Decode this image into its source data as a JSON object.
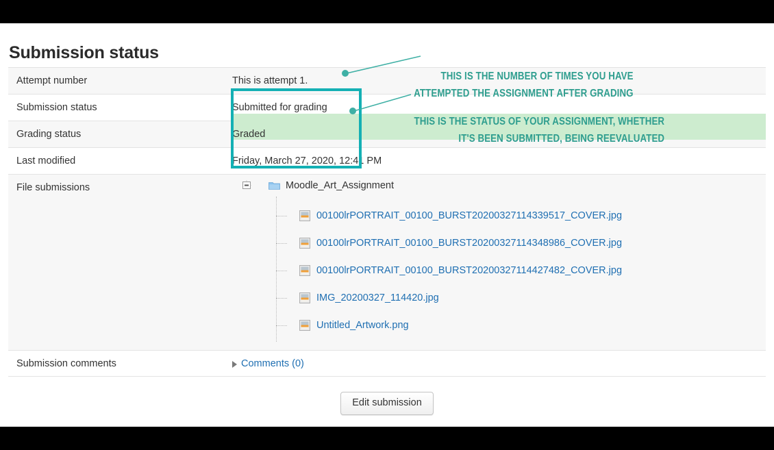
{
  "page": {
    "title": "Submission status"
  },
  "status_table": {
    "rows": [
      {
        "label": "Attempt number",
        "value": "This is attempt 1."
      },
      {
        "label": "Submission status",
        "value": "Submitted for grading"
      },
      {
        "label": "Grading status",
        "value": "Graded"
      },
      {
        "label": "Last modified",
        "value": "Friday, March 27, 2020, 12:41 PM"
      },
      {
        "label": "File submissions",
        "value": ""
      },
      {
        "label": "Submission comments",
        "value": ""
      }
    ]
  },
  "file_submissions": {
    "collapse_icon": "minus-box-icon",
    "folder_icon": "folder-icon",
    "folder_name": "Moodle_Art_Assignment",
    "files": [
      {
        "icon": "image-file-icon",
        "name": "00100lrPORTRAIT_00100_BURST20200327114339517_COVER.jpg"
      },
      {
        "icon": "image-file-icon",
        "name": "00100lrPORTRAIT_00100_BURST20200327114348986_COVER.jpg"
      },
      {
        "icon": "image-file-icon",
        "name": "00100lrPORTRAIT_00100_BURST20200327114427482_COVER.jpg"
      },
      {
        "icon": "image-file-icon",
        "name": "IMG_20200327_114420.jpg"
      },
      {
        "icon": "image-file-icon",
        "name": "Untitled_Artwork.png"
      }
    ]
  },
  "comments": {
    "toggle_icon": "triangle-right-icon",
    "link_label": "Comments (0)"
  },
  "actions": {
    "edit_submission_label": "Edit submission"
  },
  "annotations": [
    {
      "line1": "THIS IS THE NUMBER OF TIMES YOU HAVE",
      "line2": "ATTEMPTED THE ASSIGNMENT AFTER GRADING"
    },
    {
      "line1": "THIS IS THE STATUS OF YOUR ASSIGNMENT, WHETHER",
      "line2": "IT'S BEEN SUBMITTED, BEING REEVALUATED"
    }
  ],
  "colors": {
    "annotation_teal": "#2f9e8f",
    "highlight_box": "#14b0b4",
    "highlight_band": "#cdeccf",
    "link_blue": "#1f6fb2"
  }
}
